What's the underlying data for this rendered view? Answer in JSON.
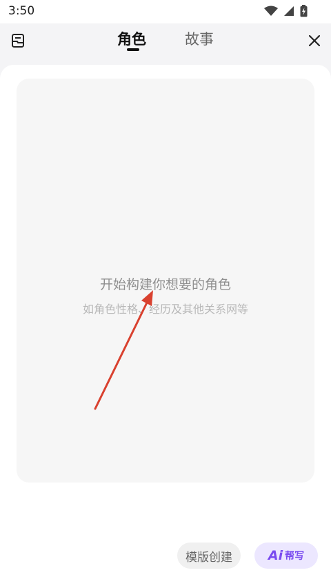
{
  "status_bar": {
    "time": "3:50"
  },
  "header": {
    "tabs": [
      {
        "label": "角色",
        "active": true
      },
      {
        "label": "故事",
        "active": false
      }
    ]
  },
  "empty_state": {
    "title": "开始构建你想要的角色",
    "subtitle": "如角色性格、经历及其他关系网等"
  },
  "bottom_bar": {
    "template_button": "模版创建",
    "ai_button": {
      "logo": "Ai",
      "label": "帮写"
    }
  },
  "icons": {
    "left": "drafts-box-icon",
    "right": "close-icon",
    "status": [
      "wifi-icon",
      "signal-icon",
      "battery-charging-icon"
    ]
  },
  "colors": {
    "accent_ai": "#7a4cf0",
    "annotation_arrow": "#d9412f"
  }
}
